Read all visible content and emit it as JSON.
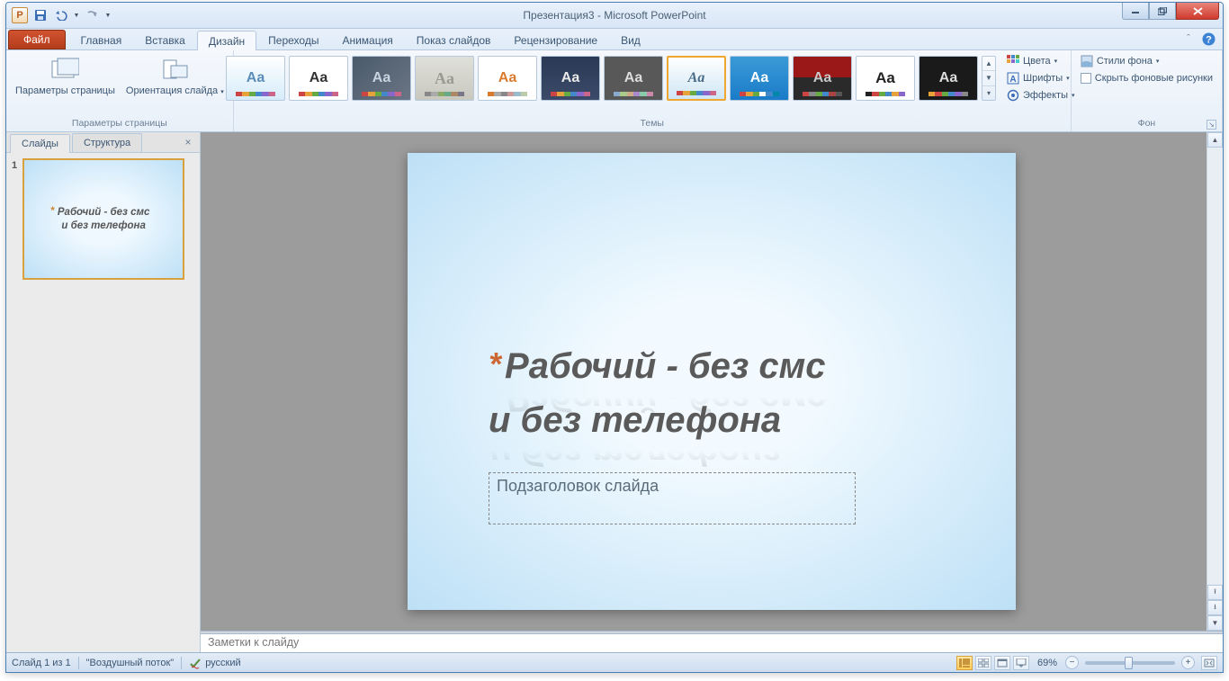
{
  "title": "Презентация3  -  Microsoft PowerPoint",
  "qat": {
    "save": "Сохранить",
    "undo": "Отменить",
    "redo": "Повторить"
  },
  "tabs": {
    "file": "Файл",
    "home": "Главная",
    "insert": "Вставка",
    "design": "Дизайн",
    "transitions": "Переходы",
    "animation": "Анимация",
    "slideshow": "Показ слайдов",
    "review": "Рецензирование",
    "view": "Вид"
  },
  "ribbon": {
    "page_setup_group": "Параметры страницы",
    "page_setup": "Параметры страницы",
    "orientation": "Ориентация слайда",
    "themes_group": "Темы",
    "colors": "Цвета",
    "fonts": "Шрифты",
    "effects": "Эффекты",
    "bg_group": "Фон",
    "bg_styles": "Стили фона",
    "hide_bg": "Скрыть фоновые рисунки"
  },
  "left_pane": {
    "slides_tab": "Слайды",
    "outline_tab": "Структура",
    "thumb_num": "1",
    "thumb_title_l1": "Рабочий - без смс",
    "thumb_title_l2": "и без телефона"
  },
  "slide": {
    "title_l1": "Рабочий - без смс",
    "title_l2": "и без телефона",
    "subtitle_placeholder": "Подзаголовок слайда"
  },
  "notes_placeholder": "Заметки к слайду",
  "status": {
    "slide_of": "Слайд 1 из 1",
    "theme": "\"Воздушный поток\"",
    "lang": "русский",
    "zoom": "69%"
  }
}
